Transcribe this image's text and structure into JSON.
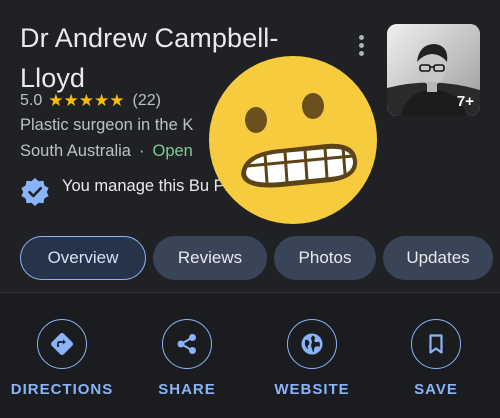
{
  "business": {
    "name": "Dr Andrew Campbell-Lloyd",
    "rating": "5.0",
    "stars": 5,
    "review_count": "(22)",
    "category": "Plastic surgeon in the K",
    "location": "South Australia",
    "separator": "·",
    "status": "Open",
    "manage_text": "You manage this Bu Profile",
    "photo_count": "7+"
  },
  "tabs": [
    {
      "label": "Overview",
      "active": true
    },
    {
      "label": "Reviews",
      "active": false
    },
    {
      "label": "Photos",
      "active": false
    },
    {
      "label": "Updates",
      "active": false
    }
  ],
  "actions": [
    {
      "label": "DIRECTIONS",
      "icon": "directions-icon"
    },
    {
      "label": "SHARE",
      "icon": "share-icon"
    },
    {
      "label": "WEBSITE",
      "icon": "globe-icon"
    },
    {
      "label": "SAVE",
      "icon": "bookmark-icon"
    }
  ],
  "colors": {
    "background": "#202124",
    "accent": "#8ab4f8",
    "star": "#fbbc04",
    "open": "#81c995",
    "chip": "#394457",
    "emoji": "#f6cc3e"
  }
}
